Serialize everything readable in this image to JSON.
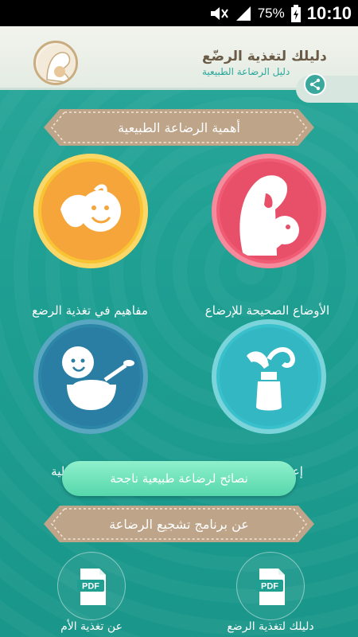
{
  "status_bar": {
    "battery_percent": "75%",
    "time": "10:10",
    "icons": [
      "mute-icon",
      "signal-icon",
      "battery-icon"
    ]
  },
  "header": {
    "title": "دليلك لتغذية الرضّع",
    "subtitle": "دليل الرضاعة الطبيعية",
    "share_icon": "share-icon"
  },
  "section_banner": "أهمية الرضاعة الطبيعية",
  "topics": [
    {
      "label": "الأوضاع الصحيحة للإرضاع",
      "icon": "mother-breastfeeding-icon",
      "ring": "#f05c74"
    },
    {
      "label": "مفاهيم في تغذية الرضع",
      "icon": "baby-feeding-icon",
      "ring": "#f8c433"
    },
    {
      "label": "إعتصار الحليب",
      "icon": "breast-pump-icon",
      "ring": "#38c0cc"
    },
    {
      "label": "التغذية التكميلية",
      "icon": "baby-bowl-icon",
      "ring": "#2c86a8"
    }
  ],
  "tips_button": "نصائح لرضاعة طبيعية ناجحة",
  "program_banner": "عن برنامج تشجيع الرضاعة",
  "pdfs": [
    {
      "label": "دليلك لتغذية الرضع",
      "icon": "pdf-icon",
      "badge": "PDF"
    },
    {
      "label": "عن تغذية الأم",
      "icon": "pdf-icon",
      "badge": "PDF"
    }
  ],
  "colors": {
    "background": "#1f9e92",
    "banner": "#bfa58a",
    "pill": "#6fe0b8"
  }
}
